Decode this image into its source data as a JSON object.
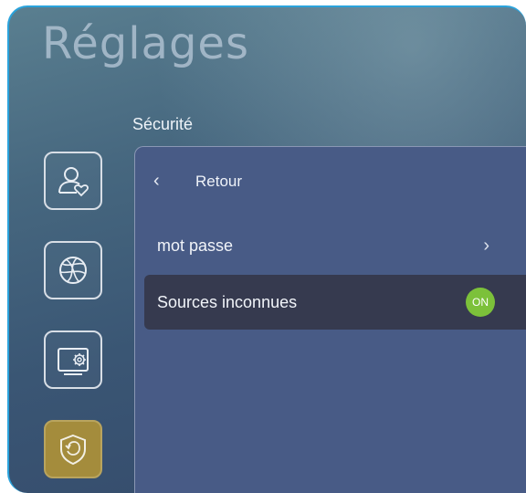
{
  "header": {
    "title": "Réglages"
  },
  "section": {
    "title": "Sécurité"
  },
  "nav": {
    "items": [
      {
        "name": "user-icon"
      },
      {
        "name": "network-globe-icon"
      },
      {
        "name": "display-settings-icon"
      },
      {
        "name": "security-shield-icon",
        "active": true
      }
    ]
  },
  "panel": {
    "back_label": "Retour",
    "rows": [
      {
        "label": "mot passe",
        "control": "chevron-right-icon"
      },
      {
        "label": "Sources inconnues",
        "toggle": "ON"
      }
    ]
  },
  "colors": {
    "accent_active": "#a48c3c",
    "toggle_on": "#7cc13a",
    "panel": "#485b86",
    "highlight_row": "#363a4f",
    "frame_border": "#2aa3dc"
  }
}
